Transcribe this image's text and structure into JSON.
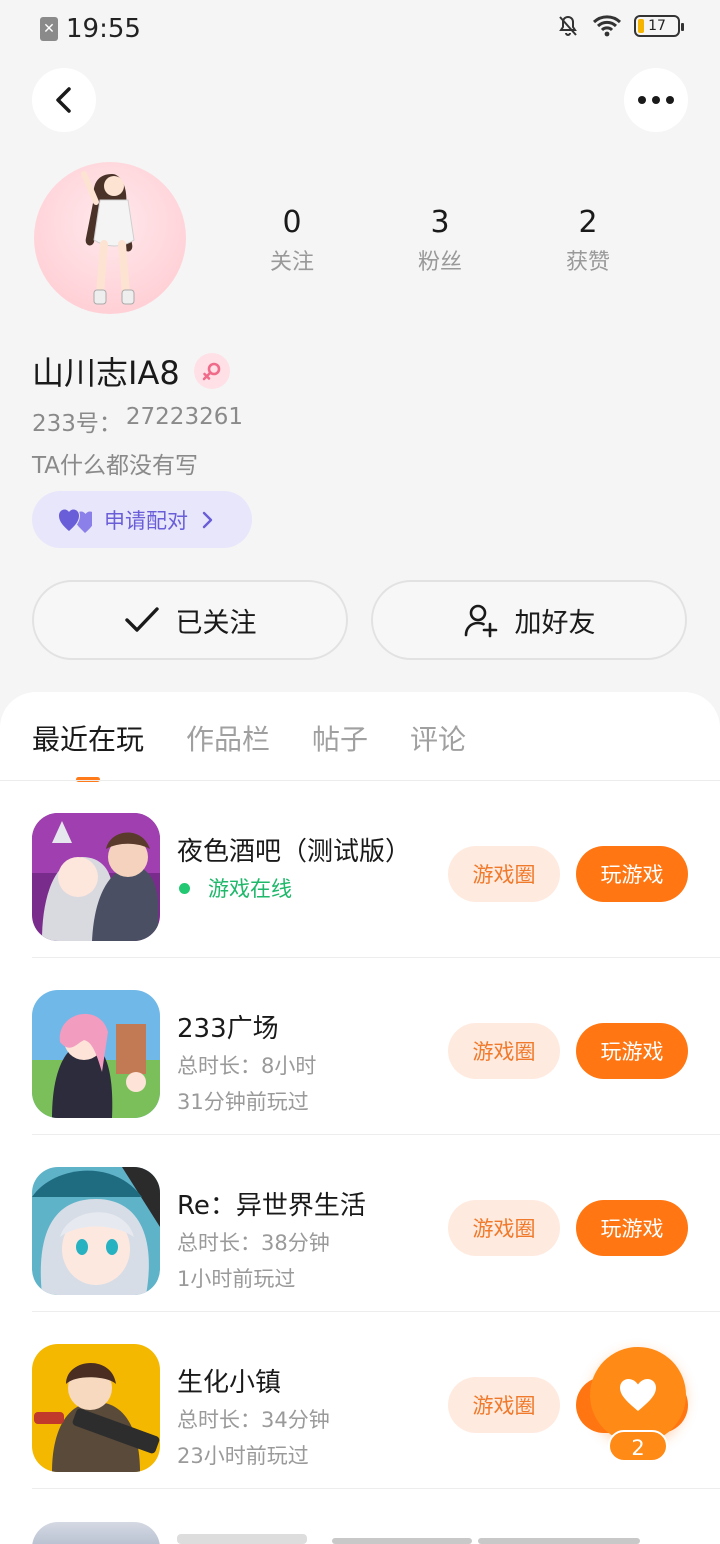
{
  "status_bar": {
    "time": "19:55",
    "battery": "17"
  },
  "profile": {
    "username": "山川志IA8",
    "uid_label": "233号：",
    "uid": "27223261",
    "bio": "TA什么都没有写",
    "pair_label": "申请配对",
    "stats": [
      {
        "num": "0",
        "label": "关注"
      },
      {
        "num": "3",
        "label": "粉丝"
      },
      {
        "num": "2",
        "label": "获赞"
      }
    ],
    "follow_label": "已关注",
    "add_friend_label": "加好友"
  },
  "tabs": [
    "最近在玩",
    "作品栏",
    "帖子",
    "评论"
  ],
  "games": [
    {
      "name": "夜色酒吧（测试版）",
      "status": "游戏在线",
      "duration": "",
      "last_played": "",
      "circle_label": "游戏圈",
      "play_label": "玩游戏"
    },
    {
      "name": "233广场",
      "status": "",
      "duration": "总时长：8小时",
      "last_played": "31分钟前玩过",
      "circle_label": "游戏圈",
      "play_label": "玩游戏"
    },
    {
      "name": "Re：异世界生活",
      "status": "",
      "duration": "总时长：38分钟",
      "last_played": "1小时前玩过",
      "circle_label": "游戏圈",
      "play_label": "玩游戏"
    },
    {
      "name": "生化小镇",
      "status": "",
      "duration": "总时长：34分钟",
      "last_played": "23小时前玩过",
      "circle_label": "游戏圈",
      "play_label": "玩游戏"
    }
  ],
  "float_like": {
    "count": "2"
  },
  "colors": {
    "accent": "#ff7612",
    "online": "#1fb86b",
    "pair": "#6a5ed8"
  }
}
